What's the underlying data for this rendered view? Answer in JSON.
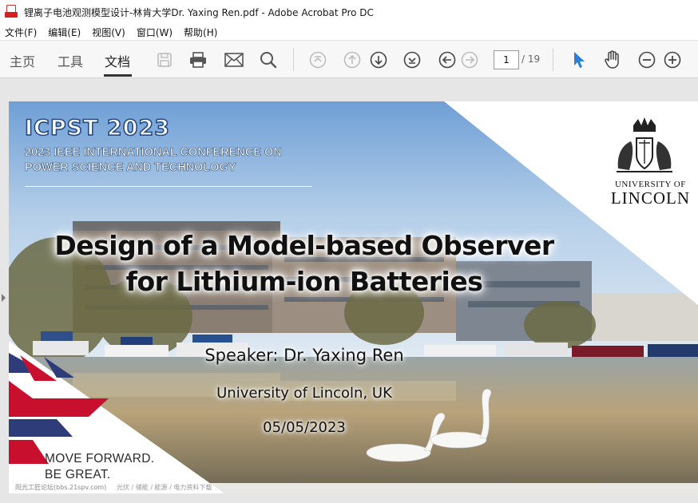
{
  "window": {
    "title": "锂离子电池观测模型设计-林肯大学Dr. Yaxing Ren.pdf - Adobe Acrobat Pro DC"
  },
  "menu": [
    "文件(F)",
    "编辑(E)",
    "视图(V)",
    "窗口(W)",
    "帮助(H)"
  ],
  "tabs": [
    "主页",
    "工具",
    "文档"
  ],
  "active_tab": "文档",
  "toolbar": {
    "icons": [
      "save-icon",
      "print-icon",
      "email-icon",
      "search-icon",
      "first-page-icon",
      "prev-page-icon",
      "next-page-icon",
      "last-page-icon",
      "back-icon",
      "forward-icon",
      "select-cursor-icon",
      "hand-tool-icon",
      "zoom-out-icon",
      "zoom-in-icon"
    ],
    "page_current": "1",
    "page_total": "/ 19",
    "accent": "#2d7fd3"
  },
  "slide": {
    "conf_short": "ICPST 2023",
    "conf_line1": "2023 IEEE INTERNATIONAL CONFERENCE ON",
    "conf_line2": "POWER SCIENCE AND TECHNOLOGY",
    "uni_top": "UNIVERSITY OF",
    "uni_name": "LINCOLN",
    "title_line1": "Design of a Model-based Observer",
    "title_line2": "for Lithium-ion Batteries",
    "speaker": "Speaker: Dr. Yaxing Ren",
    "affiliation": "University of Lincoln, UK",
    "date": "05/05/2023",
    "slogan_line1": "MOVE FORWARD.",
    "slogan_line2": "BE GREAT.",
    "watermark_left": "阳光工匠论坛(bbs.21spv.com)",
    "watermark_right": "光伏 / 储能 / 能源 / 电力资料下载"
  }
}
